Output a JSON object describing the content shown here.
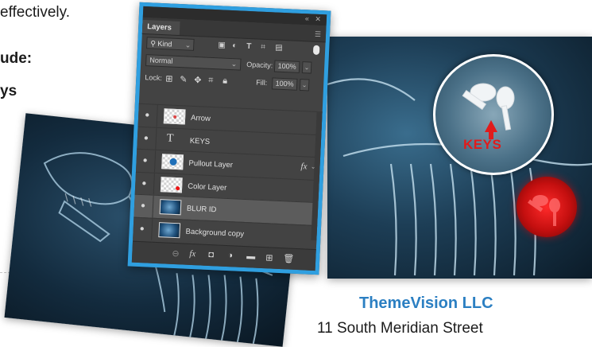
{
  "document": {
    "line1": "effectively.",
    "line2": "ude:",
    "line3": "ys",
    "company": "ThemeVision LLC",
    "address": "11 South Meridian Street"
  },
  "overlay": {
    "keys_label": "KEYS"
  },
  "panel": {
    "title_controls": [
      "«",
      "✕"
    ],
    "tab_label": "Layers",
    "filter": {
      "label": "Kind",
      "icons": [
        "image-filter-icon",
        "adjustment-filter-icon",
        "type-filter-icon",
        "shape-filter-icon",
        "smart-object-filter-icon"
      ]
    },
    "blend_mode": "Normal",
    "opacity_label": "Opacity:",
    "opacity_value": "100%",
    "lock_label": "Lock:",
    "fill_label": "Fill:",
    "fill_value": "100%",
    "layers": [
      {
        "name": "Arrow",
        "kind": "raster",
        "selected": false
      },
      {
        "name": "KEYS",
        "kind": "type",
        "selected": false
      },
      {
        "name": "Pullout Layer",
        "kind": "raster",
        "selected": false,
        "fx": "fx"
      },
      {
        "name": "Color Layer",
        "kind": "raster",
        "selected": false
      },
      {
        "name": "BLUR ID",
        "kind": "photo",
        "selected": true
      },
      {
        "name": "Background copy",
        "kind": "photo",
        "selected": false
      }
    ],
    "footer_icons": [
      "link-layers-icon",
      "fx-icon",
      "mask-icon",
      "adjustment-layer-icon",
      "group-folder-icon",
      "new-layer-icon",
      "trash-icon"
    ]
  },
  "colors": {
    "panel_border": "#2f9fe0",
    "company_blue": "#2b7fc2",
    "keys_red": "#e11b1b"
  }
}
